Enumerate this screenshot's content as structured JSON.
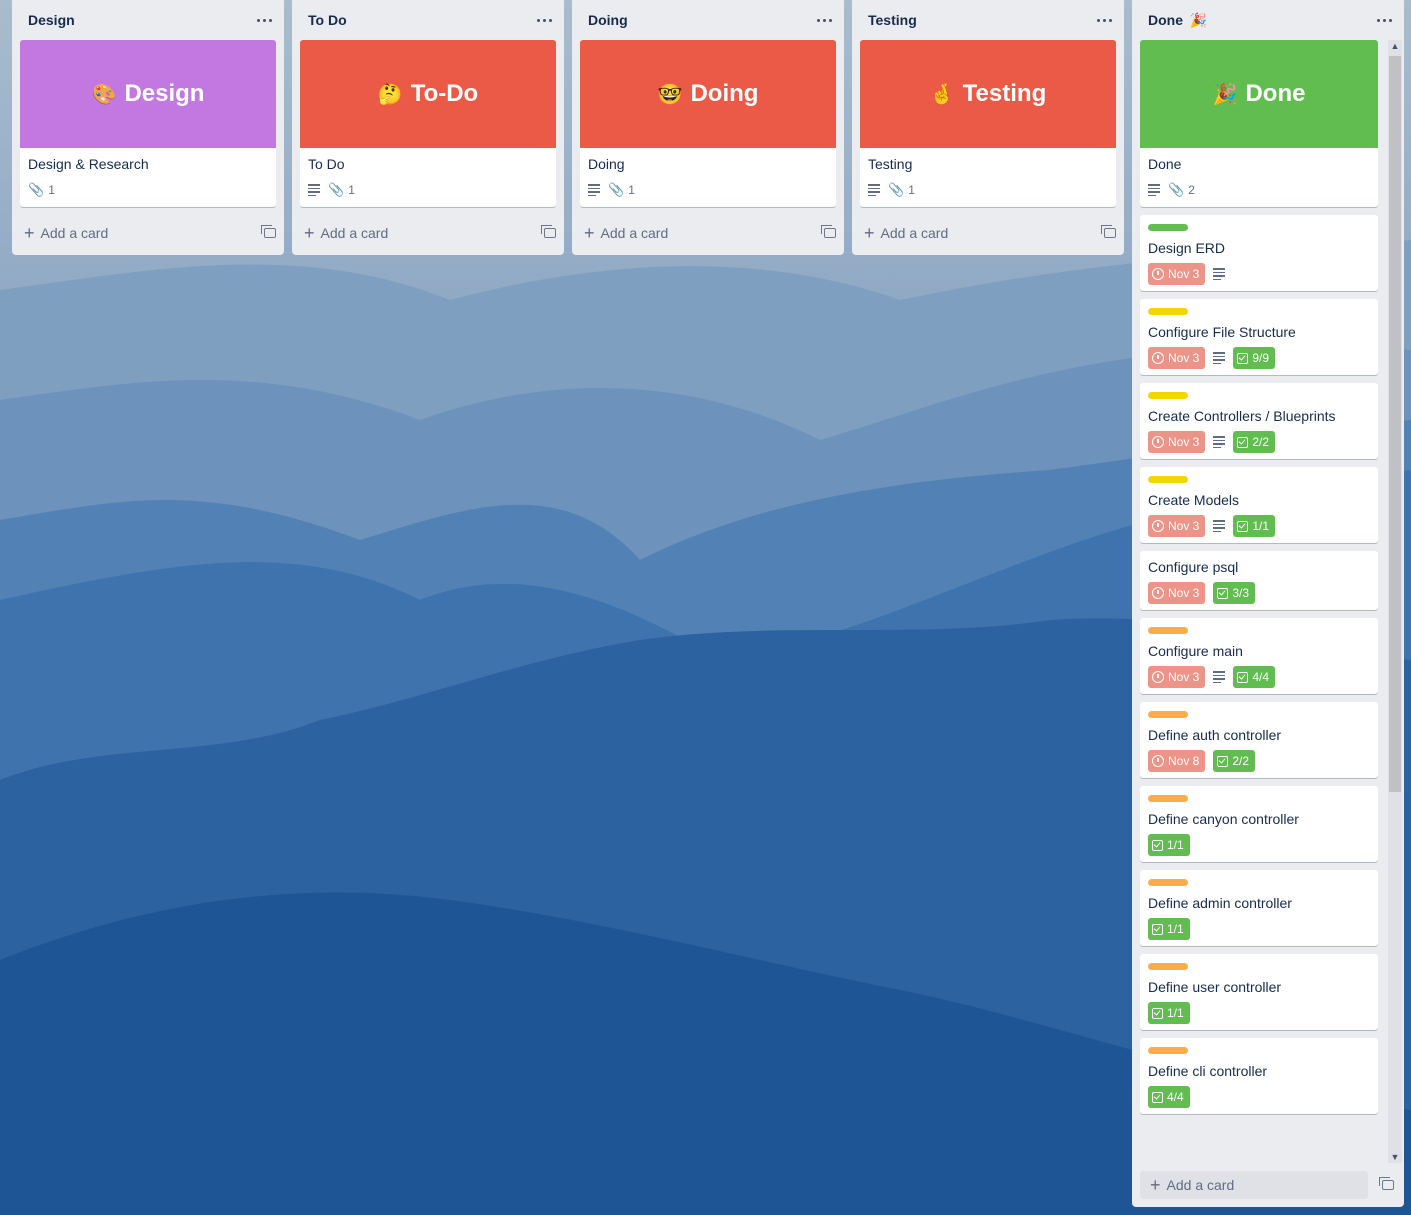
{
  "colors": {
    "purple_cover": "#c377e0",
    "red_cover": "#eb5a46",
    "green_cover": "#61bd4f",
    "label_green": "#61bd4f",
    "label_yellow": "#f2d600",
    "label_orange": "#ffab4a",
    "due_overdue": "#ec9488",
    "checklist_complete": "#61bd4f"
  },
  "lists": [
    {
      "title": "Design",
      "cover": {
        "emoji": "🎨",
        "text": "Design"
      },
      "card": {
        "title": "Design & Research",
        "attachments": "1"
      },
      "add_label": "Add a card"
    },
    {
      "title": "To Do",
      "cover": {
        "emoji": "🤔",
        "text": "To-Do"
      },
      "card": {
        "title": "To Do",
        "attachments": "1"
      },
      "add_label": "Add a card"
    },
    {
      "title": "Doing",
      "cover": {
        "emoji": "🤓",
        "text": "Doing"
      },
      "card": {
        "title": "Doing",
        "attachments": "1"
      },
      "add_label": "Add a card"
    },
    {
      "title": "Testing",
      "cover": {
        "emoji": "🤞",
        "text": "Testing"
      },
      "card": {
        "title": "Testing",
        "attachments": "1"
      },
      "add_label": "Add a card"
    }
  ],
  "done": {
    "title": "Done",
    "title_emoji": "🎉",
    "cover": {
      "emoji": "🎉",
      "text": "Done"
    },
    "cover_card": {
      "title": "Done",
      "attachments": "2"
    },
    "cards": [
      {
        "title": "Design ERD",
        "due": "Nov 3",
        "checklist": ""
      },
      {
        "title": "Configure File Structure",
        "due": "Nov 3",
        "checklist": "9/9"
      },
      {
        "title": "Create Controllers / Blueprints",
        "due": "Nov 3",
        "checklist": "2/2"
      },
      {
        "title": "Create Models",
        "due": "Nov 3",
        "checklist": "1/1"
      },
      {
        "title": "Configure psql",
        "due": "Nov 3",
        "checklist": "3/3"
      },
      {
        "title": "Configure main",
        "due": "Nov 3",
        "checklist": "4/4"
      },
      {
        "title": "Define auth controller",
        "due": "Nov 8",
        "checklist": "2/2"
      },
      {
        "title": "Define canyon controller",
        "due": "",
        "checklist": "1/1"
      },
      {
        "title": "Define admin controller",
        "due": "",
        "checklist": "1/1"
      },
      {
        "title": "Define user controller",
        "due": "",
        "checklist": "1/1"
      },
      {
        "title": "Define cli controller",
        "due": "",
        "checklist": "4/4"
      }
    ],
    "add_label": "Add a card"
  },
  "icons": {
    "list_menu": "ellipsis-icon",
    "description": "description-icon",
    "attachment": "paperclip-icon",
    "due": "clock-icon",
    "checklist": "checkbox-icon",
    "add": "plus-icon",
    "template": "card-template-icon"
  }
}
